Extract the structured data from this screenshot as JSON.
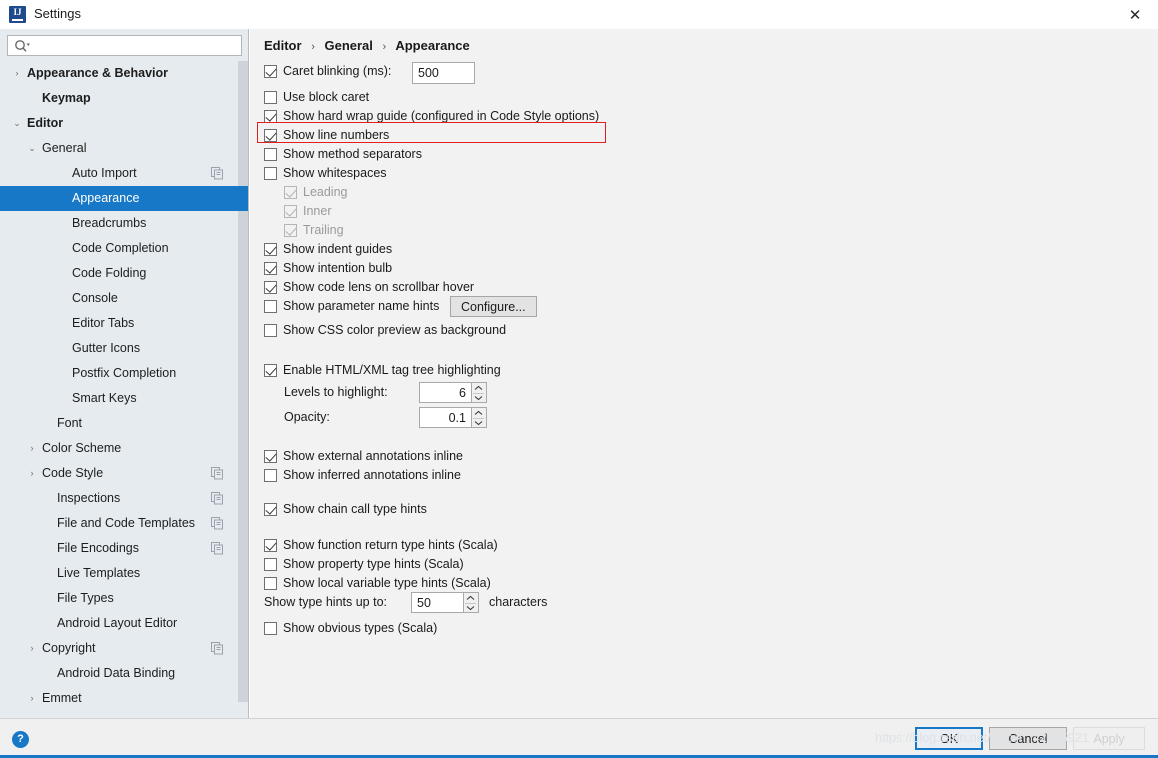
{
  "window": {
    "title": "Settings",
    "logo_icon": "intellij-idea-logo",
    "close_icon": "✕"
  },
  "sidebar": {
    "search": {
      "value": "",
      "placeholder": "",
      "icon": "search-icon"
    },
    "items": [
      {
        "label": "Appearance & Behavior",
        "indent": 0,
        "arrow": "›",
        "bold": true,
        "selected": false,
        "scope_icon": false
      },
      {
        "label": "Keymap",
        "indent": 1,
        "arrow": "",
        "bold": true,
        "selected": false,
        "scope_icon": false
      },
      {
        "label": "Editor",
        "indent": 0,
        "arrow": "⌄",
        "bold": true,
        "selected": false,
        "scope_icon": false
      },
      {
        "label": "General",
        "indent": 1,
        "arrow": "⌄",
        "bold": false,
        "selected": false,
        "scope_icon": false
      },
      {
        "label": "Auto Import",
        "indent": 3,
        "arrow": "",
        "bold": false,
        "selected": false,
        "scope_icon": true
      },
      {
        "label": "Appearance",
        "indent": 3,
        "arrow": "",
        "bold": false,
        "selected": true,
        "scope_icon": false
      },
      {
        "label": "Breadcrumbs",
        "indent": 3,
        "arrow": "",
        "bold": false,
        "selected": false,
        "scope_icon": false
      },
      {
        "label": "Code Completion",
        "indent": 3,
        "arrow": "",
        "bold": false,
        "selected": false,
        "scope_icon": false
      },
      {
        "label": "Code Folding",
        "indent": 3,
        "arrow": "",
        "bold": false,
        "selected": false,
        "scope_icon": false
      },
      {
        "label": "Console",
        "indent": 3,
        "arrow": "",
        "bold": false,
        "selected": false,
        "scope_icon": false
      },
      {
        "label": "Editor Tabs",
        "indent": 3,
        "arrow": "",
        "bold": false,
        "selected": false,
        "scope_icon": false
      },
      {
        "label": "Gutter Icons",
        "indent": 3,
        "arrow": "",
        "bold": false,
        "selected": false,
        "scope_icon": false
      },
      {
        "label": "Postfix Completion",
        "indent": 3,
        "arrow": "",
        "bold": false,
        "selected": false,
        "scope_icon": false
      },
      {
        "label": "Smart Keys",
        "indent": 3,
        "arrow": "",
        "bold": false,
        "selected": false,
        "scope_icon": false
      },
      {
        "label": "Font",
        "indent": 2,
        "arrow": "",
        "bold": false,
        "selected": false,
        "scope_icon": false
      },
      {
        "label": "Color Scheme",
        "indent": 1,
        "arrow": "›",
        "bold": false,
        "selected": false,
        "scope_icon": false
      },
      {
        "label": "Code Style",
        "indent": 1,
        "arrow": "›",
        "bold": false,
        "selected": false,
        "scope_icon": true
      },
      {
        "label": "Inspections",
        "indent": 2,
        "arrow": "",
        "bold": false,
        "selected": false,
        "scope_icon": true
      },
      {
        "label": "File and Code Templates",
        "indent": 2,
        "arrow": "",
        "bold": false,
        "selected": false,
        "scope_icon": true
      },
      {
        "label": "File Encodings",
        "indent": 2,
        "arrow": "",
        "bold": false,
        "selected": false,
        "scope_icon": true
      },
      {
        "label": "Live Templates",
        "indent": 2,
        "arrow": "",
        "bold": false,
        "selected": false,
        "scope_icon": false
      },
      {
        "label": "File Types",
        "indent": 2,
        "arrow": "",
        "bold": false,
        "selected": false,
        "scope_icon": false
      },
      {
        "label": "Android Layout Editor",
        "indent": 2,
        "arrow": "",
        "bold": false,
        "selected": false,
        "scope_icon": false
      },
      {
        "label": "Copyright",
        "indent": 1,
        "arrow": "›",
        "bold": false,
        "selected": false,
        "scope_icon": true
      },
      {
        "label": "Android Data Binding",
        "indent": 2,
        "arrow": "",
        "bold": false,
        "selected": false,
        "scope_icon": false
      },
      {
        "label": "Emmet",
        "indent": 1,
        "arrow": "›",
        "bold": false,
        "selected": false,
        "scope_icon": false
      }
    ]
  },
  "breadcrumb": {
    "part1": "Editor",
    "part2": "General",
    "part3": "Appearance",
    "separator": "›"
  },
  "settings": {
    "caret_blinking_label": "Caret blinking (ms):",
    "caret_blinking_value": "500",
    "use_block_caret": "Use block caret",
    "show_hard_wrap_guide": "Show hard wrap guide (configured in Code Style options)",
    "show_line_numbers": "Show line numbers",
    "show_method_separators": "Show method separators",
    "show_whitespaces": "Show whitespaces",
    "leading": "Leading",
    "inner": "Inner",
    "trailing": "Trailing",
    "show_indent_guides": "Show indent guides",
    "show_intention_bulb": "Show intention bulb",
    "show_code_lens": "Show code lens on scrollbar hover",
    "show_parameter_name_hints": "Show parameter name hints",
    "configure_button": "Configure...",
    "show_css_color_preview": "Show CSS color preview as background",
    "enable_html_xml": "Enable HTML/XML tag tree highlighting",
    "levels_label": "Levels to highlight:",
    "levels_value": "6",
    "opacity_label": "Opacity:",
    "opacity_value": "0.1",
    "show_external_annotations": "Show external annotations inline",
    "show_inferred_annotations": "Show inferred annotations inline",
    "show_chain_call_hints": "Show chain call type hints",
    "show_function_return_hints": "Show function return type hints (Scala)",
    "show_property_hints": "Show property type hints (Scala)",
    "show_local_variable_hints": "Show local variable type hints (Scala)",
    "type_hints_up_to_label": "Show type hints up to:",
    "type_hints_up_to_value": "50",
    "characters_label": "characters",
    "show_obvious_types": "Show obvious types (Scala)",
    "spinner_up_icon": "︿",
    "spinner_down_icon": "﹀"
  },
  "bottom": {
    "help_icon": "?",
    "ok": "OK",
    "cancel": "Cancel",
    "apply": "Apply",
    "watermark": "https://blog.csdn.net/weixin_42385921"
  },
  "colors": {
    "accent": "#1878c8",
    "selection": "#1878c8",
    "highlight_border": "#e02020",
    "sidebar_bg": "#e6ebef",
    "main_bg": "#f2f2f2"
  }
}
